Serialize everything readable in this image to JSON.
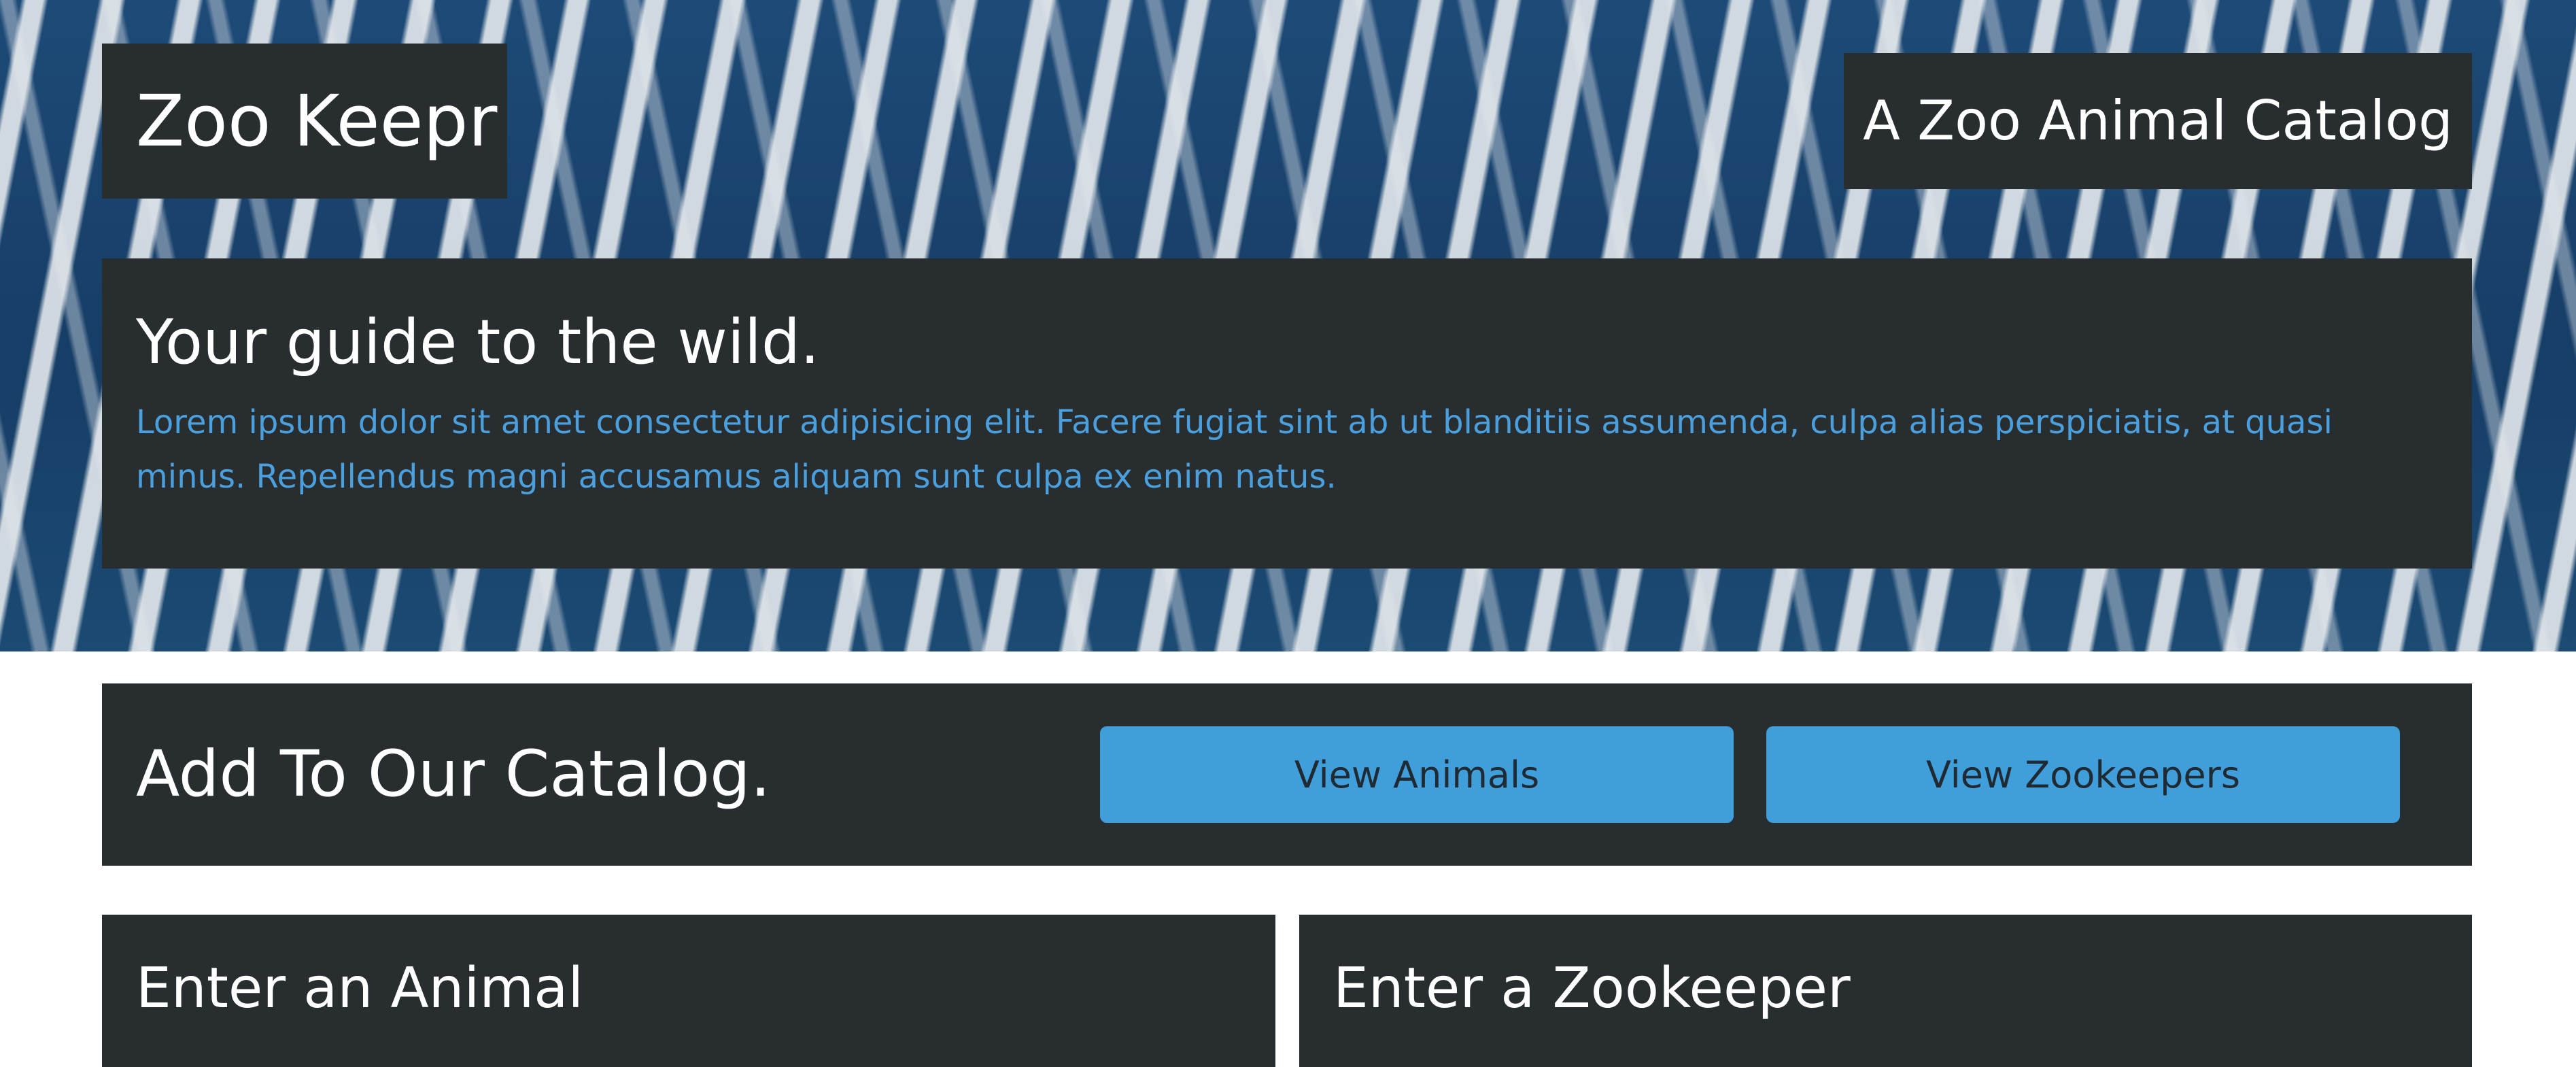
{
  "header": {
    "brand": "Zoo Keepr",
    "tagline": "A Zoo Animal Catalog"
  },
  "hero": {
    "heading": "Your guide to the wild.",
    "text": "Lorem ipsum dolor sit amet consectetur adipisicing elit. Facere fugiat sint ab ut blanditiis assumenda, culpa alias perspiciatis, at quasi minus. Repellendus magni accusamus aliquam sunt culpa ex enim natus."
  },
  "catalog": {
    "title": "Add To Our Catalog.",
    "view_animals_label": "View Animals",
    "view_zookeepers_label": "View Zookeepers"
  },
  "forms": {
    "animal_title": "Enter an Animal",
    "zookeeper_title": "Enter a Zookeeper"
  },
  "colors": {
    "panel": "#282d30",
    "accent": "#409fdb",
    "hero_text": "#4a9fdc",
    "hero_background": "#1b4570"
  }
}
